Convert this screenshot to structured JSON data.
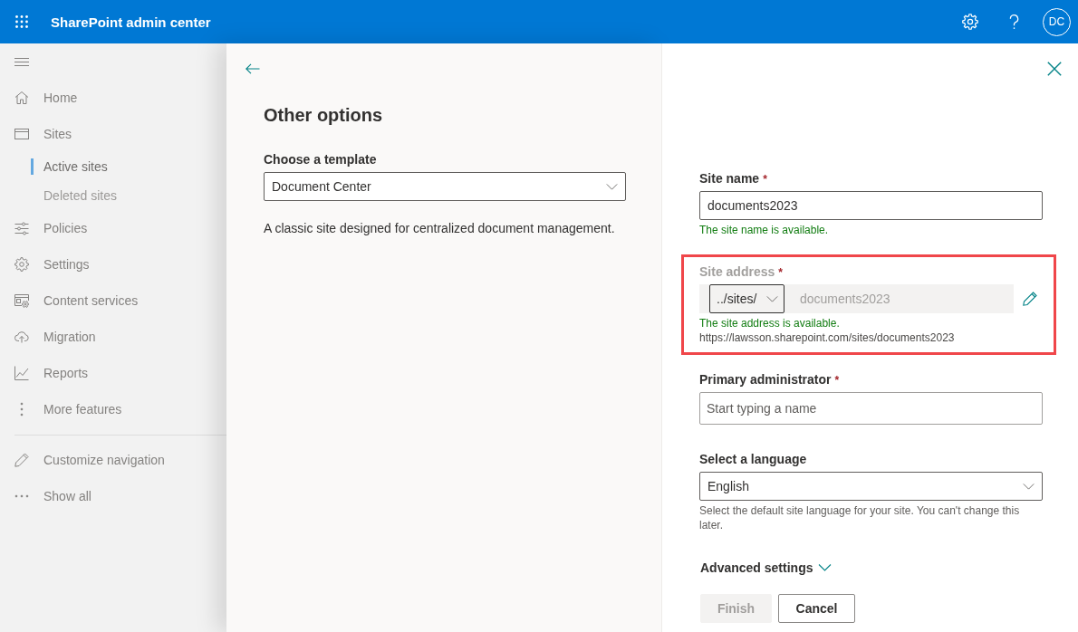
{
  "top_bar": {
    "title": "SharePoint admin center",
    "avatar_initials": "DC"
  },
  "sidebar": {
    "items": [
      {
        "label": "Home",
        "selected": false
      },
      {
        "label": "Sites",
        "selected": false,
        "children": [
          {
            "label": "Active sites",
            "selected": true
          },
          {
            "label": "Deleted sites",
            "selected": false
          }
        ]
      },
      {
        "label": "Policies",
        "selected": false
      },
      {
        "label": "Settings",
        "selected": false
      },
      {
        "label": "Content services",
        "selected": false
      },
      {
        "label": "Migration",
        "selected": false
      },
      {
        "label": "Reports",
        "selected": false
      },
      {
        "label": "More features",
        "selected": false
      }
    ],
    "footer_items": [
      {
        "label": "Customize navigation"
      },
      {
        "label": "Show all"
      }
    ]
  },
  "template_panel": {
    "heading": "Other options",
    "template": {
      "label": "Choose a template",
      "value": "Document Center"
    },
    "description": "A classic site designed for centralized document management."
  },
  "form": {
    "fields": [
      {
        "kind": "text",
        "label": "Site name",
        "required_mark": "*",
        "value": "documents2023",
        "disabled": false,
        "highlighted": false,
        "messages": [
          {
            "kind": "success",
            "text": "The site name is available."
          }
        ]
      },
      {
        "kind": "address",
        "label": "Site address",
        "required_mark": "*",
        "prefix": "../sites/",
        "value": "documents2023",
        "disabled": true,
        "highlighted": true,
        "messages": [
          {
            "kind": "success",
            "text": "The site address is available."
          },
          {
            "kind": "url",
            "text": "https://lawsson.sharepoint.com/sites/documents2023"
          }
        ]
      },
      {
        "kind": "people_picker",
        "label": "Primary administrator",
        "required_mark": "*",
        "placeholder": "Start typing a name",
        "disabled": false,
        "highlighted": false
      },
      {
        "kind": "dropdown",
        "label": "Select a language",
        "value": "English",
        "disabled": false,
        "highlighted": false,
        "messages": [
          {
            "kind": "info",
            "text": "Select the default site language for your site. You can't change this later."
          }
        ]
      }
    ],
    "advanced_settings": {
      "label": "Advanced settings",
      "expanded": false
    },
    "buttons": [
      {
        "kind": "primary",
        "label": "Finish",
        "disabled": true
      },
      {
        "kind": "default",
        "label": "Cancel",
        "disabled": false
      }
    ]
  }
}
